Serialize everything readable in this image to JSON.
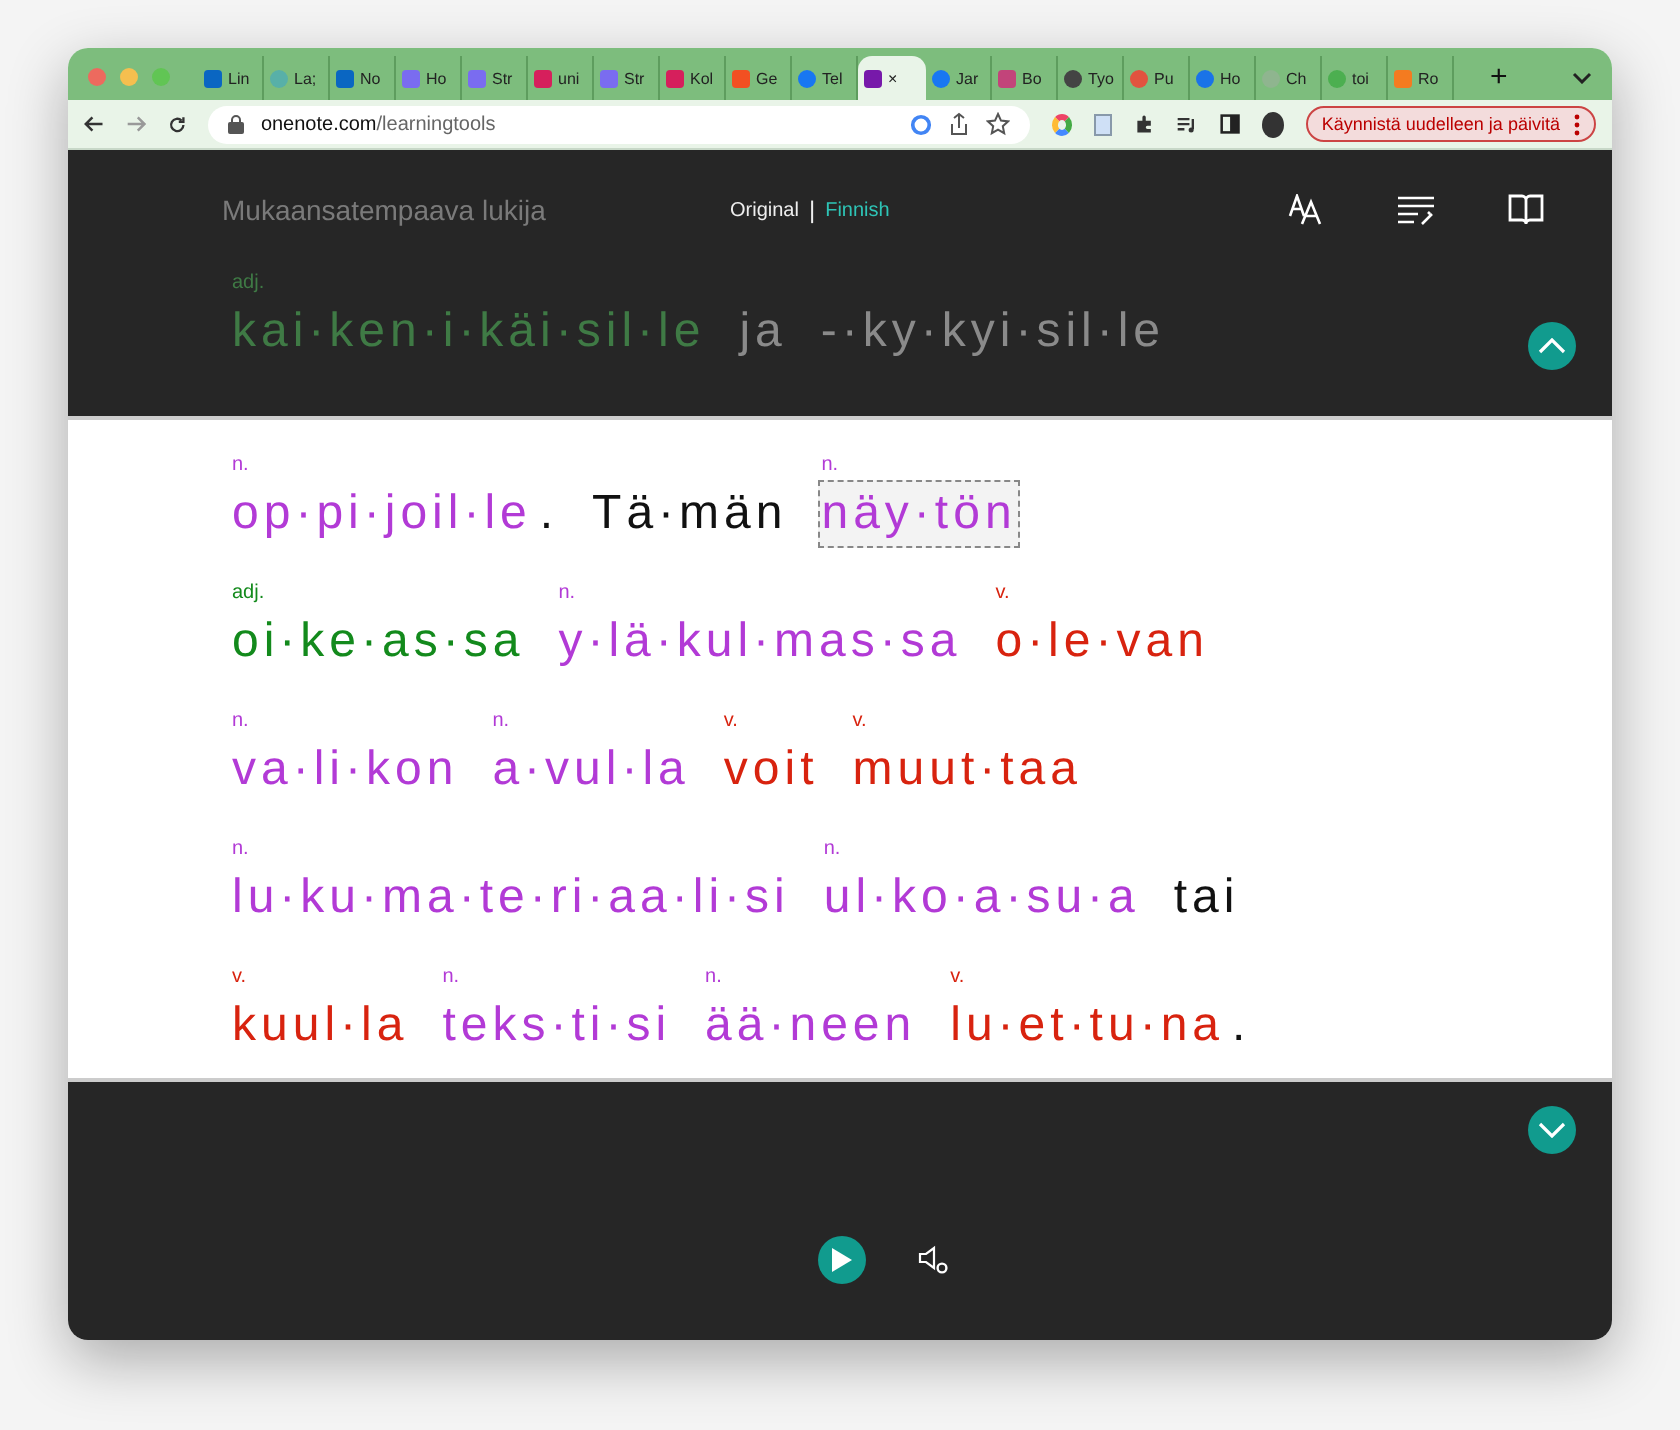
{
  "tabs": [
    {
      "label": "Lin",
      "selected": false
    },
    {
      "label": "La;",
      "selected": false
    },
    {
      "label": "No",
      "selected": false
    },
    {
      "label": "Ho",
      "selected": false
    },
    {
      "label": "Str",
      "selected": false
    },
    {
      "label": "uni",
      "selected": false
    },
    {
      "label": "Str",
      "selected": false
    },
    {
      "label": "Kol",
      "selected": false
    },
    {
      "label": "Ge",
      "selected": false
    },
    {
      "label": "Tel",
      "selected": false
    },
    {
      "label": "×",
      "selected": true
    },
    {
      "label": "Jar",
      "selected": false
    },
    {
      "label": "Bo",
      "selected": false
    },
    {
      "label": "Tyo",
      "selected": false
    },
    {
      "label": "Pu",
      "selected": false
    },
    {
      "label": "Ho",
      "selected": false
    },
    {
      "label": "Ch",
      "selected": false
    },
    {
      "label": "toi",
      "selected": false
    },
    {
      "label": "Ro",
      "selected": false
    }
  ],
  "new_tab": "+",
  "address": {
    "host": "onenote.com",
    "path": "/learningtools"
  },
  "update_button": "Käynnistä uudelleen ja päivitä",
  "header": {
    "title": "Mukaansatempaava lukija",
    "original": "Original",
    "separator": "|",
    "language": "Finnish"
  },
  "faded_line": [
    {
      "pos": "adj.",
      "text": "kai·ken·i·käi·sil·le",
      "kind": "adj"
    },
    {
      "text": "ja",
      "kind": "plain"
    },
    {
      "text": "-·ky·kyi·sil·le",
      "kind": "plain"
    }
  ],
  "lines": [
    [
      {
        "pos": "n.",
        "text": "op·pi·joil·le",
        "kind": "noun",
        "selected": false
      },
      {
        "text": ".",
        "kind": "punct",
        "selected": false
      },
      {
        "text": "Tä·män",
        "kind": "plain",
        "selected": false
      },
      {
        "pos": "n.",
        "text": "näy·tön",
        "kind": "noun",
        "selected": true
      }
    ],
    [
      {
        "pos": "adj.",
        "text": "oi·ke·as·sa",
        "kind": "adj",
        "selected": false
      },
      {
        "pos": "n.",
        "text": "y·lä·kul·mas·sa",
        "kind": "noun",
        "selected": false
      },
      {
        "pos": "v.",
        "text": "o·le·van",
        "kind": "verb",
        "selected": false
      }
    ],
    [
      {
        "pos": "n.",
        "text": "va·li·kon",
        "kind": "noun",
        "selected": false
      },
      {
        "pos": "n.",
        "text": "a·vul·la",
        "kind": "noun",
        "selected": false
      },
      {
        "pos": "v.",
        "text": "voit",
        "kind": "verb",
        "selected": false
      },
      {
        "pos": "v.",
        "text": "muut·taa",
        "kind": "verb",
        "selected": false
      }
    ],
    [
      {
        "pos": "n.",
        "text": "lu·ku·ma·te·ri·aa·li·si",
        "kind": "noun",
        "selected": false
      },
      {
        "pos": "n.",
        "text": "ul·ko·a·su·a",
        "kind": "noun",
        "selected": false
      },
      {
        "text": "tai",
        "kind": "plain",
        "selected": false
      }
    ],
    [
      {
        "pos": "v.",
        "text": "kuul·la",
        "kind": "verb",
        "selected": false
      },
      {
        "pos": "n.",
        "text": "teks·ti·si",
        "kind": "noun",
        "selected": false
      },
      {
        "pos": "n.",
        "text": "ää·neen",
        "kind": "noun",
        "selected": false
      },
      {
        "pos": "v.",
        "text": "lu·et·tu·na",
        "kind": "verb",
        "selected": false
      },
      {
        "text": ".",
        "kind": "punct",
        "selected": false
      }
    ]
  ]
}
